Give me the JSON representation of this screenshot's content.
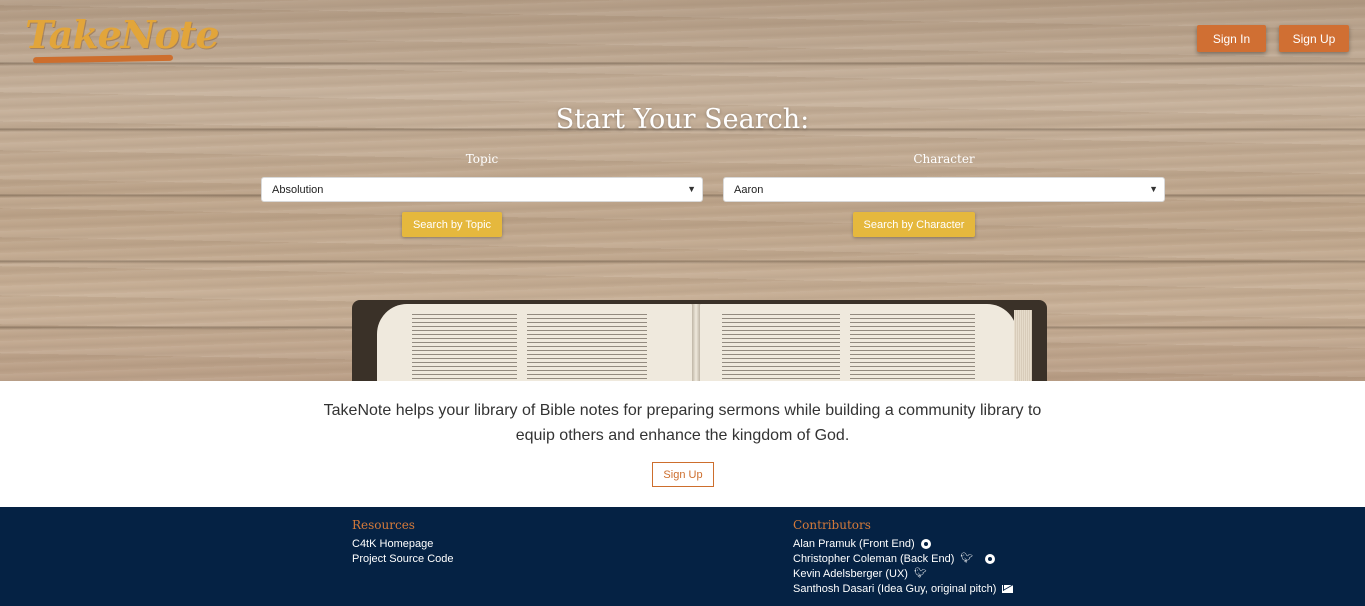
{
  "header": {
    "logo_text": "TakeNote",
    "signin_label": "Sign In",
    "signup_label": "Sign Up"
  },
  "search": {
    "title": "Start Your Search:",
    "topic": {
      "label": "Topic",
      "selected": "Absolution",
      "button_label": "Search by Topic"
    },
    "character": {
      "label": "Character",
      "selected": "Aaron",
      "button_label": "Search by Character"
    }
  },
  "intro": {
    "line1": "TakeNote helps your library of Bible notes for preparing sermons while building a community library to",
    "line2": "equip others and enhance the kingdom of God.",
    "signup_label": "Sign Up"
  },
  "footer": {
    "resources": {
      "heading": "Resources",
      "links": [
        "C4tK Homepage",
        "Project Source Code"
      ]
    },
    "contributors": {
      "heading": "Contributors",
      "people": [
        {
          "name": "Alan Pramuk (Front End)",
          "icons": [
            "github-icon"
          ]
        },
        {
          "name": "Christopher Coleman (Back End)",
          "icons": [
            "twitter-icon",
            "github-icon"
          ]
        },
        {
          "name": "Kevin Adelsberger (UX)",
          "icons": [
            "twitter-icon"
          ]
        },
        {
          "name": "Santhosh Dasari (Idea Guy, original pitch)",
          "icons": [
            "mail-icon"
          ]
        }
      ]
    }
  },
  "colors": {
    "accent_orange": "#d06f33",
    "accent_yellow": "#e5b83d",
    "footer_bg": "#052244",
    "footer_heading": "#d57a3a"
  }
}
